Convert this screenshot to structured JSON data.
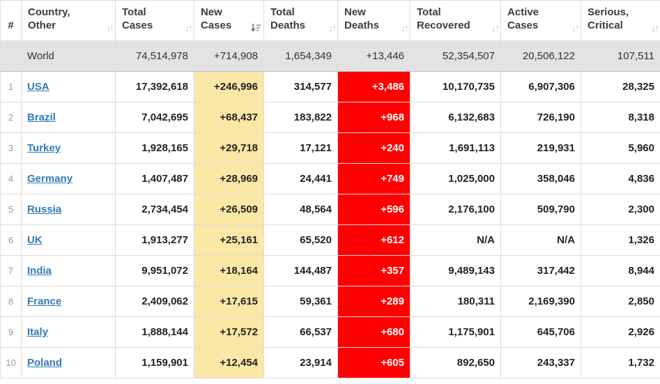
{
  "icons": {
    "sort_both": "↓↑",
    "sort_desc_name": "sort-descending-icon"
  },
  "colors": {
    "new_cases_highlight": "#FBE8A6",
    "new_deaths_highlight": "#FF0000",
    "country_link_blue": "#337ab7",
    "world_row_background": "#e3e3e3"
  },
  "table": {
    "columns": [
      {
        "label": "#",
        "sort": "none"
      },
      {
        "label": "Country, Other",
        "sort": "unsorted"
      },
      {
        "label": "Total Cases",
        "sort": "unsorted"
      },
      {
        "label": "New Cases",
        "sort": "descending"
      },
      {
        "label": "Total Deaths",
        "sort": "unsorted"
      },
      {
        "label": "New Deaths",
        "sort": "unsorted"
      },
      {
        "label": "Total Recovered",
        "sort": "unsorted"
      },
      {
        "label": "Active Cases",
        "sort": "unsorted"
      },
      {
        "label": "Serious, Critical",
        "sort": "unsorted"
      }
    ],
    "world_row": {
      "rank": "",
      "country": "World",
      "total_cases": "74,514,978",
      "new_cases": "+714,908",
      "total_deaths": "1,654,349",
      "new_deaths": "+13,446",
      "total_recovered": "52,354,507",
      "active_cases": "20,506,122",
      "serious_critical": "107,511"
    },
    "rows": [
      {
        "rank": "1",
        "country": "USA",
        "total_cases": "17,392,618",
        "new_cases": "+246,996",
        "total_deaths": "314,577",
        "new_deaths": "+3,486",
        "total_recovered": "10,170,735",
        "active_cases": "6,907,306",
        "serious_critical": "28,325"
      },
      {
        "rank": "2",
        "country": "Brazil",
        "total_cases": "7,042,695",
        "new_cases": "+68,437",
        "total_deaths": "183,822",
        "new_deaths": "+968",
        "total_recovered": "6,132,683",
        "active_cases": "726,190",
        "serious_critical": "8,318"
      },
      {
        "rank": "3",
        "country": "Turkey",
        "total_cases": "1,928,165",
        "new_cases": "+29,718",
        "total_deaths": "17,121",
        "new_deaths": "+240",
        "total_recovered": "1,691,113",
        "active_cases": "219,931",
        "serious_critical": "5,960"
      },
      {
        "rank": "4",
        "country": "Germany",
        "total_cases": "1,407,487",
        "new_cases": "+28,969",
        "total_deaths": "24,441",
        "new_deaths": "+749",
        "total_recovered": "1,025,000",
        "active_cases": "358,046",
        "serious_critical": "4,836"
      },
      {
        "rank": "5",
        "country": "Russia",
        "total_cases": "2,734,454",
        "new_cases": "+26,509",
        "total_deaths": "48,564",
        "new_deaths": "+596",
        "total_recovered": "2,176,100",
        "active_cases": "509,790",
        "serious_critical": "2,300"
      },
      {
        "rank": "6",
        "country": "UK",
        "total_cases": "1,913,277",
        "new_cases": "+25,161",
        "total_deaths": "65,520",
        "new_deaths": "+612",
        "total_recovered": "N/A",
        "active_cases": "N/A",
        "serious_critical": "1,326"
      },
      {
        "rank": "7",
        "country": "India",
        "total_cases": "9,951,072",
        "new_cases": "+18,164",
        "total_deaths": "144,487",
        "new_deaths": "+357",
        "total_recovered": "9,489,143",
        "active_cases": "317,442",
        "serious_critical": "8,944"
      },
      {
        "rank": "8",
        "country": "France",
        "total_cases": "2,409,062",
        "new_cases": "+17,615",
        "total_deaths": "59,361",
        "new_deaths": "+289",
        "total_recovered": "180,311",
        "active_cases": "2,169,390",
        "serious_critical": "2,850"
      },
      {
        "rank": "9",
        "country": "Italy",
        "total_cases": "1,888,144",
        "new_cases": "+17,572",
        "total_deaths": "66,537",
        "new_deaths": "+680",
        "total_recovered": "1,175,901",
        "active_cases": "645,706",
        "serious_critical": "2,926"
      },
      {
        "rank": "10",
        "country": "Poland",
        "total_cases": "1,159,901",
        "new_cases": "+12,454",
        "total_deaths": "23,914",
        "new_deaths": "+605",
        "total_recovered": "892,650",
        "active_cases": "243,337",
        "serious_critical": "1,732"
      }
    ]
  }
}
